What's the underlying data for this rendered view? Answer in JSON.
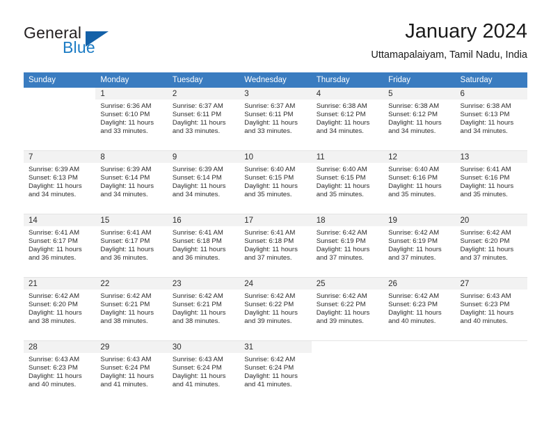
{
  "brand": {
    "word1": "General",
    "word2": "Blue",
    "triangle_color": "#1461a8",
    "blue_color": "#1b7bc4"
  },
  "header": {
    "title": "January 2024",
    "subtitle": "Uttamapalaiyam, Tamil Nadu, India"
  },
  "theme": {
    "header_bg": "#3a7cc0",
    "daynum_bg": "#f2f2f2",
    "text": "#2b2b2b"
  },
  "weekday_headers": [
    "Sunday",
    "Monday",
    "Tuesday",
    "Wednesday",
    "Thursday",
    "Friday",
    "Saturday"
  ],
  "labels": {
    "sunrise": "Sunrise:",
    "sunset": "Sunset:",
    "daylight": "Daylight:"
  },
  "weeks": [
    [
      {
        "empty": true
      },
      {
        "day": "1",
        "sunrise": "Sunrise: 6:36 AM",
        "sunset": "Sunset: 6:10 PM",
        "daylight1": "Daylight: 11 hours",
        "daylight2": "and 33 minutes."
      },
      {
        "day": "2",
        "sunrise": "Sunrise: 6:37 AM",
        "sunset": "Sunset: 6:11 PM",
        "daylight1": "Daylight: 11 hours",
        "daylight2": "and 33 minutes."
      },
      {
        "day": "3",
        "sunrise": "Sunrise: 6:37 AM",
        "sunset": "Sunset: 6:11 PM",
        "daylight1": "Daylight: 11 hours",
        "daylight2": "and 33 minutes."
      },
      {
        "day": "4",
        "sunrise": "Sunrise: 6:38 AM",
        "sunset": "Sunset: 6:12 PM",
        "daylight1": "Daylight: 11 hours",
        "daylight2": "and 34 minutes."
      },
      {
        "day": "5",
        "sunrise": "Sunrise: 6:38 AM",
        "sunset": "Sunset: 6:12 PM",
        "daylight1": "Daylight: 11 hours",
        "daylight2": "and 34 minutes."
      },
      {
        "day": "6",
        "sunrise": "Sunrise: 6:38 AM",
        "sunset": "Sunset: 6:13 PM",
        "daylight1": "Daylight: 11 hours",
        "daylight2": "and 34 minutes."
      }
    ],
    [
      {
        "day": "7",
        "sunrise": "Sunrise: 6:39 AM",
        "sunset": "Sunset: 6:13 PM",
        "daylight1": "Daylight: 11 hours",
        "daylight2": "and 34 minutes."
      },
      {
        "day": "8",
        "sunrise": "Sunrise: 6:39 AM",
        "sunset": "Sunset: 6:14 PM",
        "daylight1": "Daylight: 11 hours",
        "daylight2": "and 34 minutes."
      },
      {
        "day": "9",
        "sunrise": "Sunrise: 6:39 AM",
        "sunset": "Sunset: 6:14 PM",
        "daylight1": "Daylight: 11 hours",
        "daylight2": "and 34 minutes."
      },
      {
        "day": "10",
        "sunrise": "Sunrise: 6:40 AM",
        "sunset": "Sunset: 6:15 PM",
        "daylight1": "Daylight: 11 hours",
        "daylight2": "and 35 minutes."
      },
      {
        "day": "11",
        "sunrise": "Sunrise: 6:40 AM",
        "sunset": "Sunset: 6:15 PM",
        "daylight1": "Daylight: 11 hours",
        "daylight2": "and 35 minutes."
      },
      {
        "day": "12",
        "sunrise": "Sunrise: 6:40 AM",
        "sunset": "Sunset: 6:16 PM",
        "daylight1": "Daylight: 11 hours",
        "daylight2": "and 35 minutes."
      },
      {
        "day": "13",
        "sunrise": "Sunrise: 6:41 AM",
        "sunset": "Sunset: 6:16 PM",
        "daylight1": "Daylight: 11 hours",
        "daylight2": "and 35 minutes."
      }
    ],
    [
      {
        "day": "14",
        "sunrise": "Sunrise: 6:41 AM",
        "sunset": "Sunset: 6:17 PM",
        "daylight1": "Daylight: 11 hours",
        "daylight2": "and 36 minutes."
      },
      {
        "day": "15",
        "sunrise": "Sunrise: 6:41 AM",
        "sunset": "Sunset: 6:17 PM",
        "daylight1": "Daylight: 11 hours",
        "daylight2": "and 36 minutes."
      },
      {
        "day": "16",
        "sunrise": "Sunrise: 6:41 AM",
        "sunset": "Sunset: 6:18 PM",
        "daylight1": "Daylight: 11 hours",
        "daylight2": "and 36 minutes."
      },
      {
        "day": "17",
        "sunrise": "Sunrise: 6:41 AM",
        "sunset": "Sunset: 6:18 PM",
        "daylight1": "Daylight: 11 hours",
        "daylight2": "and 37 minutes."
      },
      {
        "day": "18",
        "sunrise": "Sunrise: 6:42 AM",
        "sunset": "Sunset: 6:19 PM",
        "daylight1": "Daylight: 11 hours",
        "daylight2": "and 37 minutes."
      },
      {
        "day": "19",
        "sunrise": "Sunrise: 6:42 AM",
        "sunset": "Sunset: 6:19 PM",
        "daylight1": "Daylight: 11 hours",
        "daylight2": "and 37 minutes."
      },
      {
        "day": "20",
        "sunrise": "Sunrise: 6:42 AM",
        "sunset": "Sunset: 6:20 PM",
        "daylight1": "Daylight: 11 hours",
        "daylight2": "and 37 minutes."
      }
    ],
    [
      {
        "day": "21",
        "sunrise": "Sunrise: 6:42 AM",
        "sunset": "Sunset: 6:20 PM",
        "daylight1": "Daylight: 11 hours",
        "daylight2": "and 38 minutes."
      },
      {
        "day": "22",
        "sunrise": "Sunrise: 6:42 AM",
        "sunset": "Sunset: 6:21 PM",
        "daylight1": "Daylight: 11 hours",
        "daylight2": "and 38 minutes."
      },
      {
        "day": "23",
        "sunrise": "Sunrise: 6:42 AM",
        "sunset": "Sunset: 6:21 PM",
        "daylight1": "Daylight: 11 hours",
        "daylight2": "and 38 minutes."
      },
      {
        "day": "24",
        "sunrise": "Sunrise: 6:42 AM",
        "sunset": "Sunset: 6:22 PM",
        "daylight1": "Daylight: 11 hours",
        "daylight2": "and 39 minutes."
      },
      {
        "day": "25",
        "sunrise": "Sunrise: 6:42 AM",
        "sunset": "Sunset: 6:22 PM",
        "daylight1": "Daylight: 11 hours",
        "daylight2": "and 39 minutes."
      },
      {
        "day": "26",
        "sunrise": "Sunrise: 6:42 AM",
        "sunset": "Sunset: 6:23 PM",
        "daylight1": "Daylight: 11 hours",
        "daylight2": "and 40 minutes."
      },
      {
        "day": "27",
        "sunrise": "Sunrise: 6:43 AM",
        "sunset": "Sunset: 6:23 PM",
        "daylight1": "Daylight: 11 hours",
        "daylight2": "and 40 minutes."
      }
    ],
    [
      {
        "day": "28",
        "sunrise": "Sunrise: 6:43 AM",
        "sunset": "Sunset: 6:23 PM",
        "daylight1": "Daylight: 11 hours",
        "daylight2": "and 40 minutes."
      },
      {
        "day": "29",
        "sunrise": "Sunrise: 6:43 AM",
        "sunset": "Sunset: 6:24 PM",
        "daylight1": "Daylight: 11 hours",
        "daylight2": "and 41 minutes."
      },
      {
        "day": "30",
        "sunrise": "Sunrise: 6:43 AM",
        "sunset": "Sunset: 6:24 PM",
        "daylight1": "Daylight: 11 hours",
        "daylight2": "and 41 minutes."
      },
      {
        "day": "31",
        "sunrise": "Sunrise: 6:42 AM",
        "sunset": "Sunset: 6:24 PM",
        "daylight1": "Daylight: 11 hours",
        "daylight2": "and 41 minutes."
      },
      {
        "empty": true
      },
      {
        "empty": true
      },
      {
        "empty": true
      }
    ]
  ]
}
